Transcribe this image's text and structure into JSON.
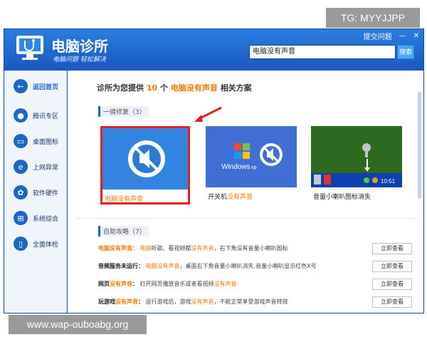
{
  "watermarks": {
    "top": "TG: MYYJJPP",
    "bottom": "www.wap-ouboabg.org"
  },
  "window": {
    "title": "电脑诊所",
    "subtitle": "电脑问题 轻松解决",
    "controls": {
      "feedback": "提交问题",
      "minimize": "—",
      "close": "✕"
    },
    "search": {
      "value": "电脑没有声音",
      "button": "搜索"
    }
  },
  "sidebar": {
    "items": [
      {
        "label": "返回首页",
        "icon": "back-arrow-icon",
        "glyph": "←"
      },
      {
        "label": "腾讯专区",
        "icon": "tencent-icon",
        "glyph": "●"
      },
      {
        "label": "桌面图标",
        "icon": "monitor-icon",
        "glyph": "▭"
      },
      {
        "label": "上网异常",
        "icon": "ie-icon",
        "glyph": "e"
      },
      {
        "label": "软件硬件",
        "icon": "hardware-icon",
        "glyph": "✿"
      },
      {
        "label": "系统综合",
        "icon": "windows-icon",
        "glyph": "⊞"
      },
      {
        "label": "全面体检",
        "icon": "phone-check-icon",
        "glyph": "▯"
      }
    ]
  },
  "main": {
    "heading": {
      "prefix": "诊所为您提供",
      "count": "10",
      "unit": "个",
      "keyword": "电脑没有声音",
      "suffix": "相关方案"
    },
    "repair": {
      "title": "一键修复（3）",
      "cards": [
        {
          "label": "电脑没有声音"
        },
        {
          "label_prefix": "开关机",
          "label_kw": "没有声音",
          "windows_text": "Windows",
          "windows_xp": "xp"
        },
        {
          "label": "音量小喇叭图标消失",
          "clock": "10:51"
        }
      ]
    },
    "guide": {
      "title": "自助攻略（7）",
      "rows": [
        {
          "title": "电脑没有声音：",
          "kw1": "电脑",
          "text1": "听歌、看视频都",
          "kw2": "没有声音",
          "text2": "，右下角没有音量小喇叭图标",
          "button": "立即查看"
        },
        {
          "title": "音频服务未运行：",
          "kw1": "电脑没有声音",
          "text1": "，桌面右下角音量小喇叭消失,音量小喇叭显示红色X号",
          "kw2": "",
          "text2": "",
          "button": "立即查看"
        },
        {
          "title_prefix": "网页",
          "title_kw": "没有声音",
          "title_suffix": "：",
          "text1": "打开网页播放音乐或者看视频",
          "kw2": "没有声音",
          "text2": "",
          "button": "立即查看"
        },
        {
          "title_prefix": "玩游戏",
          "title_kw": "没有声音",
          "title_suffix": "：",
          "text1": "运行游戏后，游戏",
          "kw2": "没有声音",
          "text2": "，不能正常享受游戏声音特效",
          "button": "立即查看"
        }
      ]
    }
  },
  "colors": {
    "accent": "#1e66c6",
    "keyword": "#f07a00",
    "highlight_border": "#e01f1f"
  }
}
